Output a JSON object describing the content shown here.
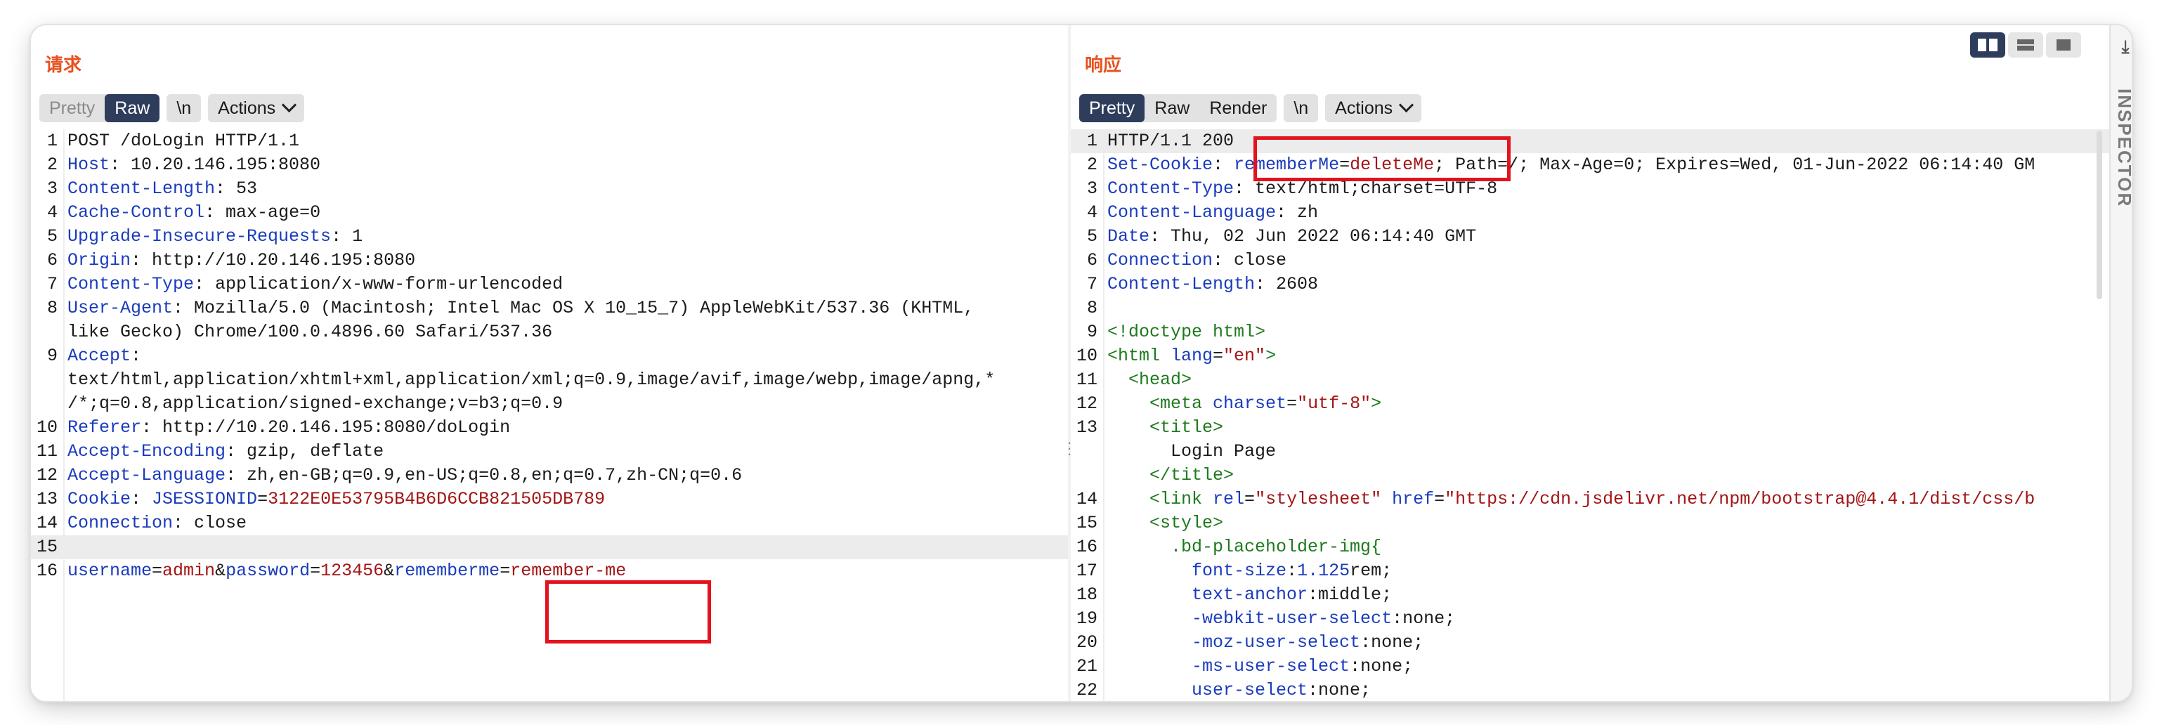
{
  "request": {
    "title": "请求",
    "tabs": [
      "Pretty",
      "Raw"
    ],
    "newline_label": "\\n",
    "actions_label": "Actions"
  },
  "response": {
    "title": "响应",
    "tabs": [
      "Pretty",
      "Raw",
      "Render"
    ],
    "newline_label": "\\n",
    "actions_label": "Actions"
  },
  "inspector": {
    "label": "INSPECTOR"
  },
  "request_lines": [
    {
      "n": "1",
      "parts": [
        [
          "POST /doLogin HTTP/1.1",
          "val"
        ]
      ]
    },
    {
      "n": "2",
      "parts": [
        [
          "Host",
          "hname"
        ],
        [
          ": 10.20.146.195:8080",
          "val"
        ]
      ]
    },
    {
      "n": "3",
      "parts": [
        [
          "Content-Length",
          "hname"
        ],
        [
          ": 53",
          "val"
        ]
      ]
    },
    {
      "n": "4",
      "parts": [
        [
          "Cache-Control",
          "hname"
        ],
        [
          ": max-age=0",
          "val"
        ]
      ]
    },
    {
      "n": "5",
      "parts": [
        [
          "Upgrade-Insecure-Requests",
          "hname"
        ],
        [
          ": 1",
          "val"
        ]
      ]
    },
    {
      "n": "6",
      "parts": [
        [
          "Origin",
          "hname"
        ],
        [
          ": http://10.20.146.195:8080",
          "val"
        ]
      ]
    },
    {
      "n": "7",
      "parts": [
        [
          "Content-Type",
          "hname"
        ],
        [
          ": application/x-www-form-urlencoded",
          "val"
        ]
      ]
    },
    {
      "n": "8",
      "parts": [
        [
          "User-Agent",
          "hname"
        ],
        [
          ": Mozilla/5.0 (Macintosh; Intel Mac OS X 10_15_7) AppleWebKit/537.36 (KHTML,",
          "val"
        ]
      ]
    },
    {
      "n": "",
      "parts": [
        [
          "like Gecko) Chrome/100.0.4896.60 Safari/537.36",
          "val"
        ]
      ]
    },
    {
      "n": "9",
      "parts": [
        [
          "Accept",
          "hname"
        ],
        [
          ":",
          "val"
        ]
      ]
    },
    {
      "n": "",
      "parts": [
        [
          "text/html,application/xhtml+xml,application/xml;q=0.9,image/avif,image/webp,image/apng,*",
          "val"
        ]
      ]
    },
    {
      "n": "",
      "parts": [
        [
          "/*;q=0.8,application/signed-exchange;v=b3;q=0.9",
          "val"
        ]
      ]
    },
    {
      "n": "10",
      "parts": [
        [
          "Referer",
          "hname"
        ],
        [
          ": http://10.20.146.195:8080/doLogin",
          "val"
        ]
      ]
    },
    {
      "n": "11",
      "parts": [
        [
          "Accept-Encoding",
          "hname"
        ],
        [
          ": gzip, deflate",
          "val"
        ]
      ]
    },
    {
      "n": "12",
      "parts": [
        [
          "Accept-Language",
          "hname"
        ],
        [
          ": zh,en-GB;q=0.9,en-US;q=0.8,en;q=0.7,zh-CN;q=0.6",
          "val"
        ]
      ]
    },
    {
      "n": "13",
      "parts": [
        [
          "Cookie",
          "hname"
        ],
        [
          ": ",
          "val"
        ],
        [
          "JSESSIONID",
          "key"
        ],
        [
          "=",
          "eq"
        ],
        [
          "3122E0E53795B4B6D6CCB821505DB789",
          "red"
        ]
      ]
    },
    {
      "n": "14",
      "parts": [
        [
          "Connection",
          "hname"
        ],
        [
          ": close",
          "val"
        ]
      ]
    },
    {
      "n": "15",
      "parts": [
        [
          "",
          "val"
        ]
      ],
      "hl": true
    },
    {
      "n": "16",
      "parts": [
        [
          "username",
          "key"
        ],
        [
          "=",
          "eq"
        ],
        [
          "admin",
          "red"
        ],
        [
          "&",
          "eq"
        ],
        [
          "password",
          "key"
        ],
        [
          "=",
          "eq"
        ],
        [
          "123456",
          "red"
        ],
        [
          "&",
          "eq"
        ],
        [
          "rememberme",
          "key"
        ],
        [
          "=",
          "eq"
        ],
        [
          "remember-me",
          "red"
        ]
      ]
    }
  ],
  "response_lines": [
    {
      "n": "1",
      "parts": [
        [
          "HTTP/1.1 200",
          "val"
        ]
      ],
      "hl": true
    },
    {
      "n": "2",
      "parts": [
        [
          "Set-Cookie",
          "hname"
        ],
        [
          ": ",
          "val"
        ],
        [
          "rememberMe",
          "key"
        ],
        [
          "=",
          "eq"
        ],
        [
          "deleteMe",
          "red"
        ],
        [
          "; Path=/; Max-Age=0; Expires=Wed, 01-Jun-2022 06:14:40 GM",
          "val"
        ]
      ]
    },
    {
      "n": "3",
      "parts": [
        [
          "Content-Type",
          "hname"
        ],
        [
          ": text/html;charset=UTF-8",
          "val"
        ]
      ]
    },
    {
      "n": "4",
      "parts": [
        [
          "Content-Language",
          "hname"
        ],
        [
          ": zh",
          "val"
        ]
      ]
    },
    {
      "n": "5",
      "parts": [
        [
          "Date",
          "hname"
        ],
        [
          ": Thu, 02 Jun 2022 06:14:40 GMT",
          "val"
        ]
      ]
    },
    {
      "n": "6",
      "parts": [
        [
          "Connection",
          "hname"
        ],
        [
          ": close",
          "val"
        ]
      ]
    },
    {
      "n": "7",
      "parts": [
        [
          "Content-Length",
          "hname"
        ],
        [
          ": 2608",
          "val"
        ]
      ]
    },
    {
      "n": "8",
      "parts": [
        [
          "",
          "val"
        ]
      ]
    },
    {
      "n": "9",
      "parts": [
        [
          "<!doctype html>",
          "tag"
        ]
      ]
    },
    {
      "n": "10",
      "parts": [
        [
          "<html ",
          "tag"
        ],
        [
          "lang",
          "pname"
        ],
        [
          "=",
          "eq"
        ],
        [
          "\"en\"",
          "pval"
        ],
        [
          ">",
          "tag"
        ]
      ]
    },
    {
      "n": "11",
      "parts": [
        [
          "  <head>",
          "tag"
        ]
      ]
    },
    {
      "n": "12",
      "parts": [
        [
          "    <meta ",
          "tag"
        ],
        [
          "charset",
          "pname"
        ],
        [
          "=",
          "eq"
        ],
        [
          "\"utf-8\"",
          "pval"
        ],
        [
          ">",
          "tag"
        ]
      ]
    },
    {
      "n": "13",
      "parts": [
        [
          "    <title>",
          "tag"
        ]
      ]
    },
    {
      "n": "",
      "parts": [
        [
          "      Login Page",
          "val"
        ]
      ]
    },
    {
      "n": "",
      "parts": [
        [
          "    </title>",
          "tag"
        ]
      ]
    },
    {
      "n": "14",
      "parts": [
        [
          "    <link ",
          "tag"
        ],
        [
          "rel",
          "pname"
        ],
        [
          "=",
          "eq"
        ],
        [
          "\"stylesheet\"",
          "pval"
        ],
        [
          " href",
          "pname"
        ],
        [
          "=",
          "eq"
        ],
        [
          "\"https://cdn.jsdelivr.net/npm/bootstrap@4.4.1/dist/css/b",
          "pval"
        ]
      ]
    },
    {
      "n": "15",
      "parts": [
        [
          "    <style>",
          "tag"
        ]
      ]
    },
    {
      "n": "16",
      "parts": [
        [
          "      .bd-placeholder-img{",
          "tag"
        ]
      ]
    },
    {
      "n": "17",
      "parts": [
        [
          "        font-size",
          "pname"
        ],
        [
          ":",
          "eq"
        ],
        [
          "1.125",
          "cssnum"
        ],
        [
          "rem;",
          "val"
        ]
      ]
    },
    {
      "n": "18",
      "parts": [
        [
          "        text-anchor",
          "pname"
        ],
        [
          ":middle;",
          "val"
        ]
      ]
    },
    {
      "n": "19",
      "parts": [
        [
          "        -webkit-user-select",
          "pname"
        ],
        [
          ":none;",
          "val"
        ]
      ]
    },
    {
      "n": "20",
      "parts": [
        [
          "        -moz-user-select",
          "pname"
        ],
        [
          ":none;",
          "val"
        ]
      ]
    },
    {
      "n": "21",
      "parts": [
        [
          "        -ms-user-select",
          "pname"
        ],
        [
          ":none;",
          "val"
        ]
      ]
    },
    {
      "n": "22",
      "parts": [
        [
          "        user-select",
          "pname"
        ],
        [
          ":none;",
          "val"
        ]
      ]
    }
  ]
}
